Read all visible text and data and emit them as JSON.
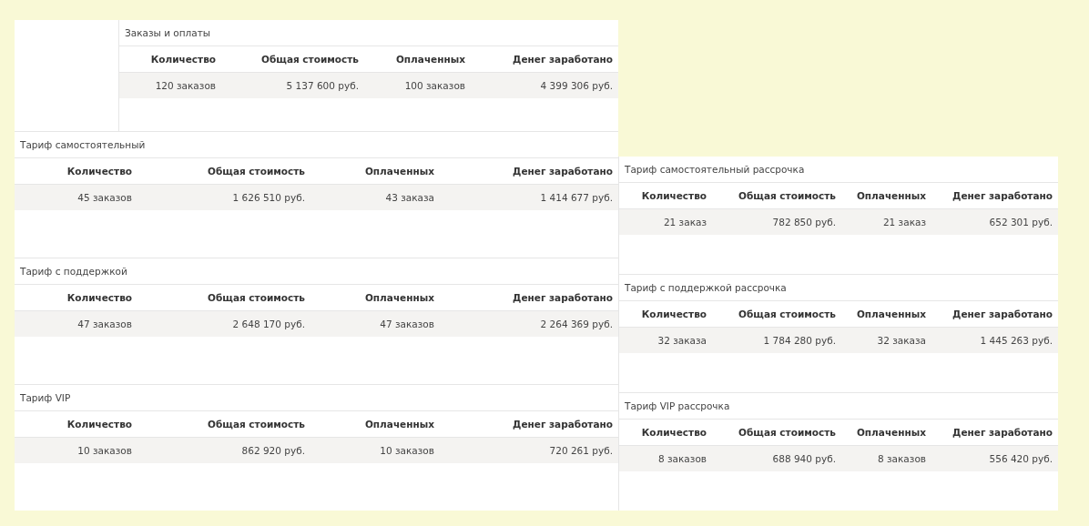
{
  "summary": {
    "title": "Заказы и оплаты",
    "columns": [
      "Количество",
      "Общая стоимость",
      "Оплаченных",
      "Денег заработано"
    ],
    "row": [
      "120 заказов",
      "5 137 600 руб.",
      "100 заказов",
      "4 399 306 руб."
    ]
  },
  "left_sections": [
    {
      "title": "Тариф самостоятельный",
      "columns": [
        "Количество",
        "Общая стоимость",
        "Оплаченных",
        "Денег заработано"
      ],
      "row": [
        "45 заказов",
        "1 626 510 руб.",
        "43 заказа",
        "1 414 677 руб."
      ]
    },
    {
      "title": "Тариф с поддержкой",
      "columns": [
        "Количество",
        "Общая стоимость",
        "Оплаченных",
        "Денег заработано"
      ],
      "row": [
        "47 заказов",
        "2 648 170 руб.",
        "47 заказов",
        "2 264 369 руб."
      ]
    },
    {
      "title": "Тариф VIP",
      "columns": [
        "Количество",
        "Общая стоимость",
        "Оплаченных",
        "Денег заработано"
      ],
      "row": [
        "10 заказов",
        "862 920 руб.",
        "10 заказов",
        "720 261 руб."
      ]
    }
  ],
  "right_sections": [
    {
      "title": "Тариф самостоятельный рассрочка",
      "columns": [
        "Количество",
        "Общая стоимость",
        "Оплаченных",
        "Денег заработано"
      ],
      "row": [
        "21 заказ",
        "782 850 руб.",
        "21 заказ",
        "652 301 руб."
      ]
    },
    {
      "title": "Тариф с поддержкой рассрочка",
      "columns": [
        "Количество",
        "Общая стоимость",
        "Оплаченных",
        "Денег заработано"
      ],
      "row": [
        "32 заказа",
        "1 784 280 руб.",
        "32 заказа",
        "1 445 263 руб."
      ]
    },
    {
      "title": "Тариф VIP рассрочка",
      "columns": [
        "Количество",
        "Общая стоимость",
        "Оплаченных",
        "Денег заработано"
      ],
      "row": [
        "8 заказов",
        "688 940 руб.",
        "8 заказов",
        "556 420 руб."
      ]
    }
  ]
}
